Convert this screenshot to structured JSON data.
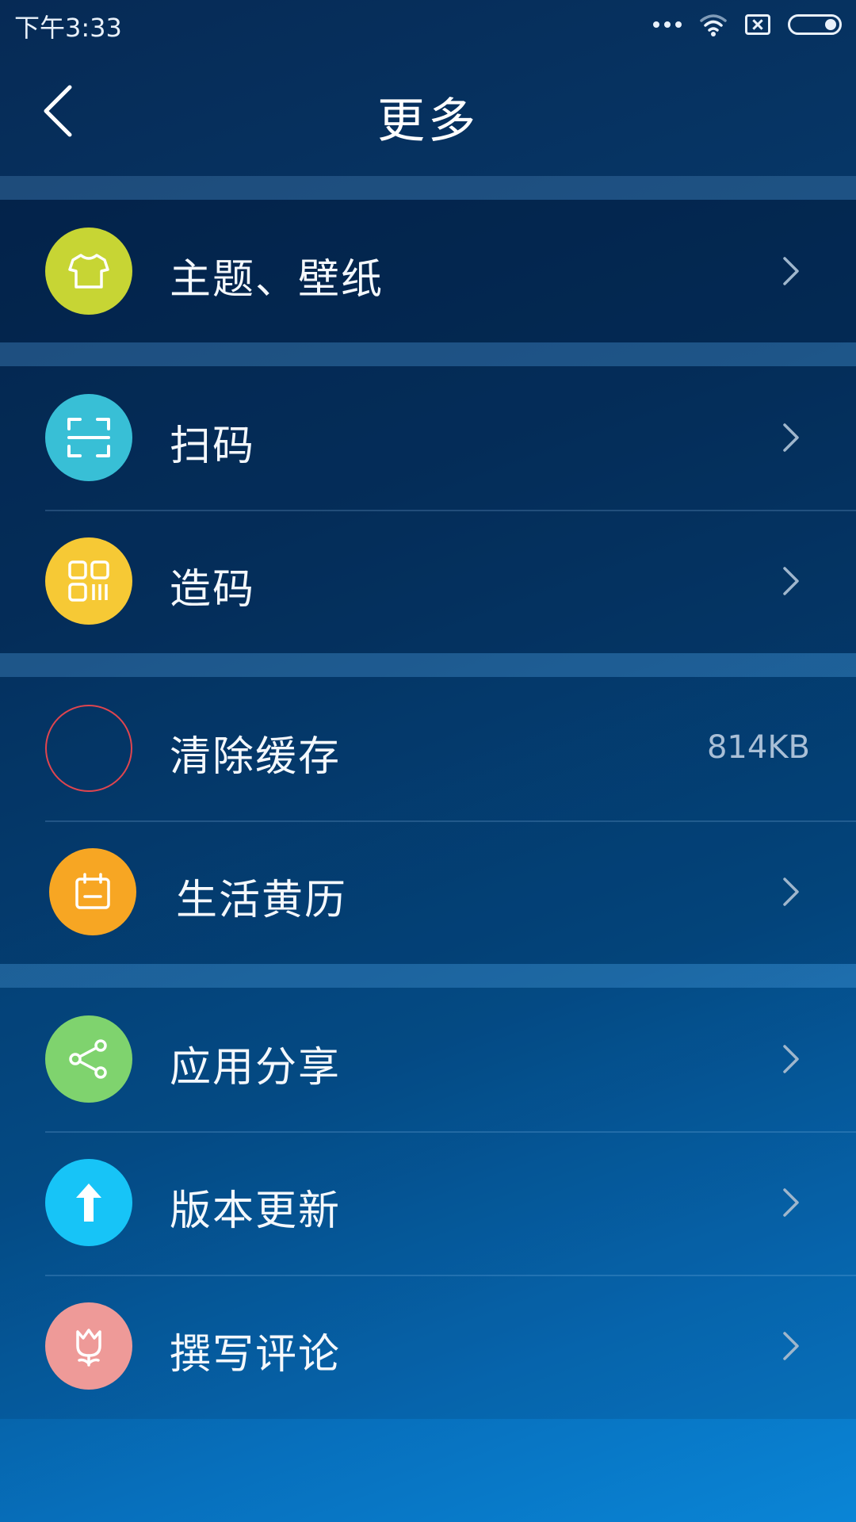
{
  "status": {
    "time": "下午3:33"
  },
  "header": {
    "title": "更多"
  },
  "groups": [
    {
      "items": [
        {
          "label": "主题、壁纸",
          "icon": "tshirt-icon",
          "color": "#c7d534"
        }
      ]
    },
    {
      "items": [
        {
          "label": "扫码",
          "icon": "scan-icon",
          "color": "#38bfd6"
        },
        {
          "label": "造码",
          "icon": "qrcode-icon",
          "color": "#f6c935"
        }
      ]
    },
    {
      "items": [
        {
          "label": "清除缓存",
          "icon": "loading-ring-icon",
          "color": "#e0454f",
          "value": "814KB"
        },
        {
          "label": "生活黄历",
          "icon": "calendar-icon",
          "color": "#f7a623"
        }
      ]
    },
    {
      "items": [
        {
          "label": "应用分享",
          "icon": "share-icon",
          "color": "#7fd36e"
        },
        {
          "label": "版本更新",
          "icon": "arrow-up-icon",
          "color": "#17c4f7"
        },
        {
          "label": "撰写评论",
          "icon": "flower-icon",
          "color": "#ee9a98"
        }
      ]
    }
  ]
}
